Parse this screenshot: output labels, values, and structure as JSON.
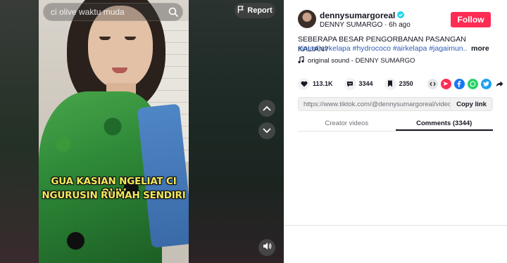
{
  "search": {
    "placeholder": "ci olive waktu muda",
    "icon": "search-icon"
  },
  "report": {
    "label": "Report",
    "icon": "flag-icon"
  },
  "video": {
    "caption_line1": "GUA KASIAN  NGELIAT CI OLIV",
    "caption_line2": "NGURUSIN RUMAH SENDIRI"
  },
  "controls": {
    "up_icon": "chevron-up-icon",
    "down_icon": "chevron-down-icon",
    "mute_icon": "volume-icon"
  },
  "author": {
    "username": "dennysumargoreal",
    "display_name": "DENNY SUMARGO",
    "separator": " · ",
    "posted": "6h ago",
    "verified": true
  },
  "follow": {
    "label": "Follow"
  },
  "post": {
    "description": "SEBERAPA BESAR PENGORBANAN PASANGAN KALIAN?",
    "hashtags": "#iniasliairkelapa #hydrococo #airkelapa #jagaimun...",
    "more_label": "more",
    "sound": "original sound - DENNY SUMARGO"
  },
  "stats": {
    "likes": "113.1K",
    "comments": "3344",
    "saves": "2350"
  },
  "share_icons": [
    "embed-icon",
    "send-icon",
    "facebook-icon",
    "whatsapp-icon",
    "twitter-icon",
    "share-icon"
  ],
  "link": {
    "url": "https://www.tiktok.com/@dennysumargoreal/video/7...",
    "copy_label": "Copy link"
  },
  "tabs": [
    {
      "label": "Creator videos",
      "active": false
    },
    {
      "label": "Comments (3344)",
      "active": true
    }
  ],
  "colors": {
    "accent": "#fe2c55",
    "hashtag": "#2b5db9",
    "caption": "#f2e85a"
  }
}
